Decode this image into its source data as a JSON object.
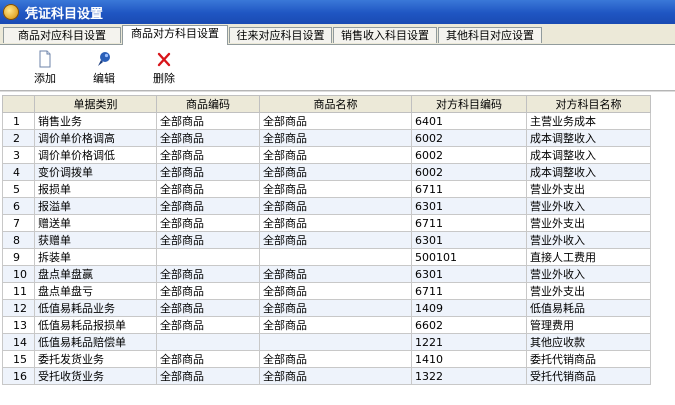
{
  "window": {
    "title": "凭证科目设置"
  },
  "tabs": [
    {
      "label": "商品对应科目设置"
    },
    {
      "label": "商品对方科目设置",
      "active": true
    },
    {
      "label": "往来对应科目设置"
    },
    {
      "label": "销售收入科目设置"
    },
    {
      "label": "其他科目对应设置"
    }
  ],
  "toolbar": {
    "add": {
      "label": "添加",
      "icon": "document-icon"
    },
    "edit": {
      "label": "编辑",
      "icon": "pen-icon"
    },
    "delete": {
      "label": "删除",
      "icon": "red-x-icon"
    }
  },
  "table": {
    "columns": [
      "",
      "单据类别",
      "商品编码",
      "商品名称",
      "对方科目编码",
      "对方科目名称"
    ],
    "rows": [
      [
        "1",
        "销售业务",
        "全部商品",
        "全部商品",
        "6401",
        "主营业务成本"
      ],
      [
        "2",
        "调价单价格调高",
        "全部商品",
        "全部商品",
        "6002",
        "成本调整收入"
      ],
      [
        "3",
        "调价单价格调低",
        "全部商品",
        "全部商品",
        "6002",
        "成本调整收入"
      ],
      [
        "4",
        "变价调拨单",
        "全部商品",
        "全部商品",
        "6002",
        "成本调整收入"
      ],
      [
        "5",
        "报损单",
        "全部商品",
        "全部商品",
        "6711",
        "营业外支出"
      ],
      [
        "6",
        "报溢单",
        "全部商品",
        "全部商品",
        "6301",
        "营业外收入"
      ],
      [
        "7",
        "赠送单",
        "全部商品",
        "全部商品",
        "6711",
        "营业外支出"
      ],
      [
        "8",
        "获赠单",
        "全部商品",
        "全部商品",
        "6301",
        "营业外收入"
      ],
      [
        "9",
        "拆装单",
        "",
        "",
        "500101",
        "直接人工费用"
      ],
      [
        "10",
        "盘点单盘赢",
        "全部商品",
        "全部商品",
        "6301",
        "营业外收入"
      ],
      [
        "11",
        "盘点单盘亏",
        "全部商品",
        "全部商品",
        "6711",
        "营业外支出"
      ],
      [
        "12",
        "低值易耗品业务",
        "全部商品",
        "全部商品",
        "1409",
        "低值易耗品"
      ],
      [
        "13",
        "低值易耗品报损单",
        "全部商品",
        "全部商品",
        "6602",
        "管理费用"
      ],
      [
        "14",
        "低值易耗品赔偿单",
        "",
        "",
        "1221",
        "其他应收款"
      ],
      [
        "15",
        "委托发货业务",
        "全部商品",
        "全部商品",
        "1410",
        "委托代销商品"
      ],
      [
        "16",
        "受托收货业务",
        "全部商品",
        "全部商品",
        "1322",
        "受托代销商品"
      ]
    ]
  }
}
